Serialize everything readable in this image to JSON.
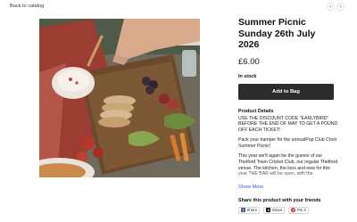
{
  "nav": {
    "back_label": "Back to catalog",
    "prev_glyph": "‹",
    "next_glyph": "›"
  },
  "product": {
    "title": "Summer Picnic Sunday 26th July 2026",
    "price": "£6.00",
    "stock_status": "In stock",
    "add_to_bag_label": "Add to Bag",
    "details_heading": "Product Details",
    "details_paragraphs": [
      "USE THE DISCOUNT CODE \"EARLYBIRD\" BEFORE THE END OF MAY TO GET A POUND OFF EACH TICKET!",
      "Pack your hamper for the annualPop Club Choir Summer Picnic!",
      "This year we'll again be the guests of our Thetford Town Cricket Club, our regular Thetford venue. The kitchen, the loos and new for this year THE BAR will be open, with the"
    ],
    "show_more_label": "Show More",
    "image_icon": "picnic-photo"
  },
  "share": {
    "heading": "Share this product with your friends",
    "buttons": [
      {
        "label": "Share",
        "icon": "facebook-icon",
        "color": "#3b5998",
        "glyph": "f"
      },
      {
        "label": "Share",
        "icon": "x-icon",
        "color": "#111111",
        "glyph": "X"
      },
      {
        "label": "Pin it",
        "icon": "pinterest-icon",
        "color": "#cb2027",
        "glyph": "P"
      }
    ]
  },
  "colors": {
    "button_bg": "#2c2c2c",
    "link": "#2a5bd7"
  }
}
